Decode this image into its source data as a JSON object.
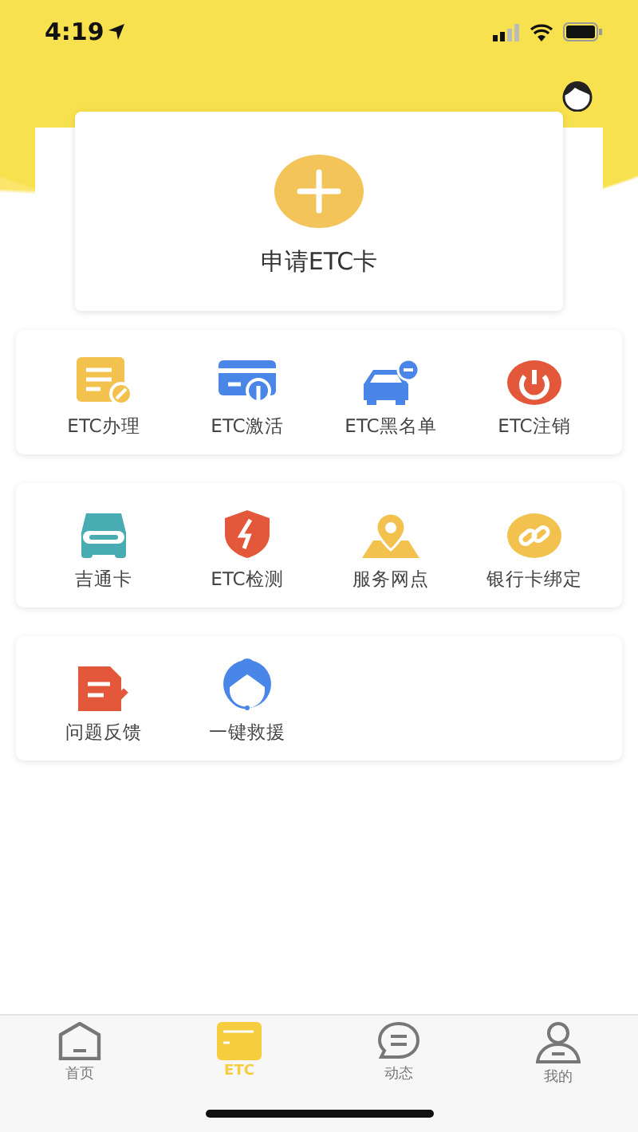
{
  "status_bar": {
    "time": "4:19"
  },
  "apply": {
    "label": "申请ETC卡"
  },
  "panels": [
    {
      "items": [
        {
          "label": "ETC办理",
          "kind": "form"
        },
        {
          "label": "ETC激活",
          "kind": "card"
        },
        {
          "label": "ETC黑名单",
          "kind": "car"
        },
        {
          "label": "ETC注销",
          "kind": "power"
        }
      ]
    },
    {
      "items": [
        {
          "label": "吉通卡",
          "kind": "etc"
        },
        {
          "label": "ETC检测",
          "kind": "shield"
        },
        {
          "label": "服务网点",
          "kind": "map"
        },
        {
          "label": "银行卡绑定",
          "kind": "link"
        }
      ]
    },
    {
      "items": [
        {
          "label": "问题反馈",
          "kind": "feedback"
        },
        {
          "label": "一键救援",
          "kind": "agent"
        }
      ]
    }
  ],
  "tabs": [
    {
      "label": "首页",
      "kind": "home",
      "selected": false
    },
    {
      "label": "ETC",
      "kind": "etc",
      "selected": true
    },
    {
      "label": "动态",
      "kind": "chat",
      "selected": false
    },
    {
      "label": "我的",
      "kind": "user",
      "selected": false
    }
  ]
}
